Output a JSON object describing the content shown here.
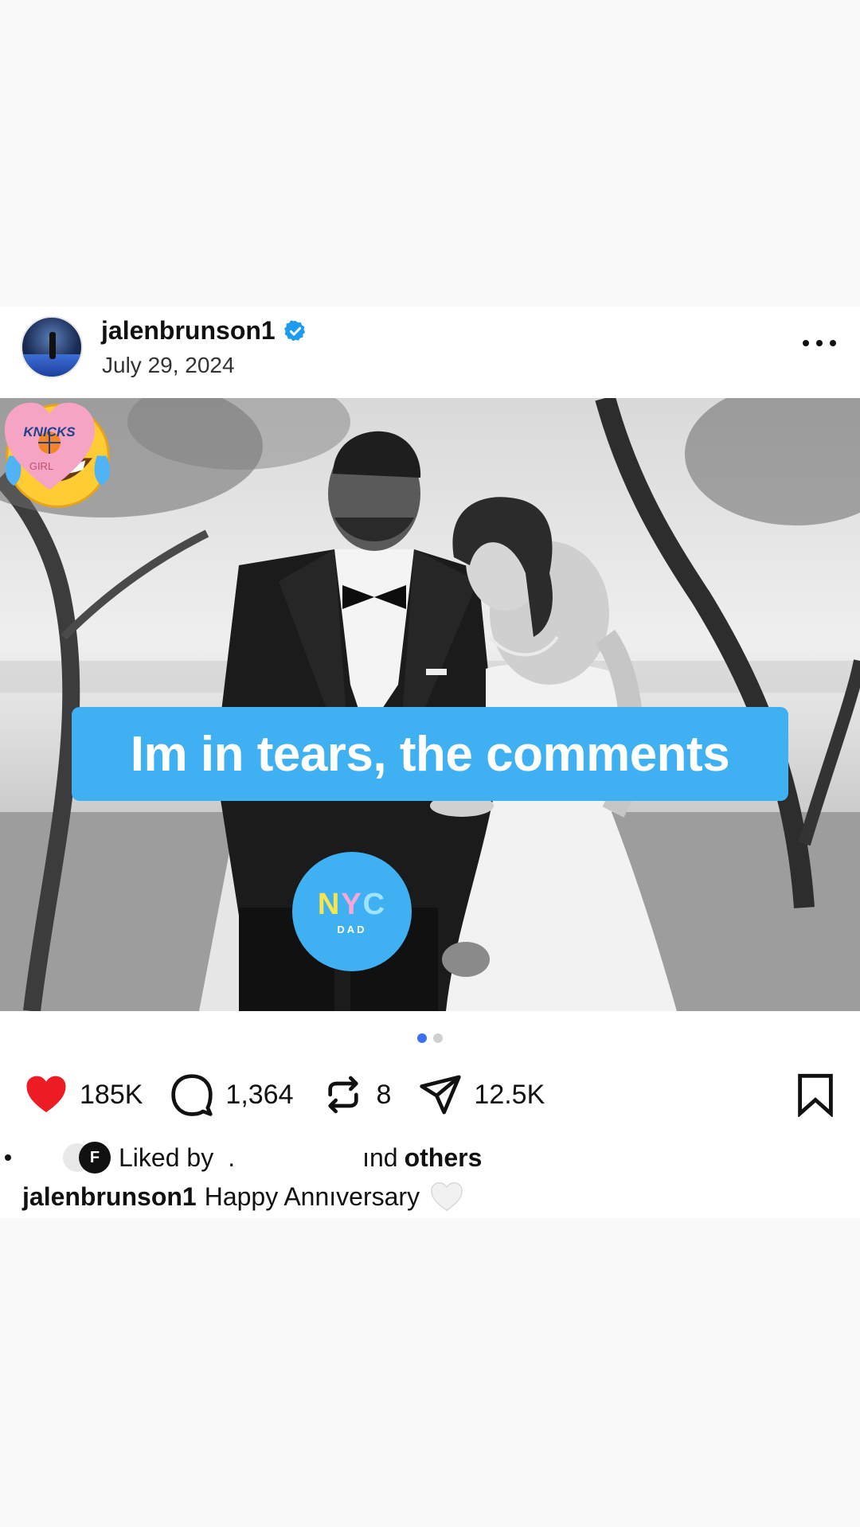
{
  "post": {
    "username": "jalenbrunson1",
    "date": "July 29, 2024",
    "overlay_text": "Im in tears, the comments",
    "sticker_nyc": {
      "line1": [
        "N",
        "Y",
        "C"
      ],
      "line2": "DAD"
    },
    "sticker_heart": {
      "team": "KNICKS",
      "label": "GIRL"
    },
    "emoji": "face-with-tears-of-joy",
    "carousel": {
      "count": 2,
      "active_index": 0
    }
  },
  "actions": {
    "likes": "185K",
    "comments": "1,364",
    "reposts": "8",
    "shares": "12.5K"
  },
  "liked_by": {
    "avatar_letter": "F",
    "prefix": "Liked by",
    "name_partial": ".",
    "suffix": "ınd",
    "others": "others"
  },
  "caption": {
    "username": "jalenbrunson1",
    "text": "Happy Annıversary"
  },
  "colors": {
    "accent_blue": "#3fb1f3",
    "like_red": "#ed1c24",
    "dot_active": "#3d6ff5",
    "verified": "#1d9bf0"
  }
}
